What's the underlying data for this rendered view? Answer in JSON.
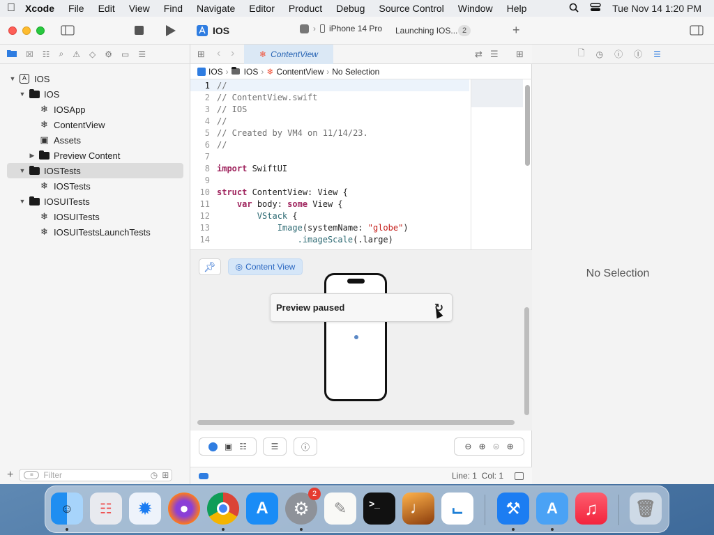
{
  "menubar": {
    "items": [
      "Xcode",
      "File",
      "Edit",
      "View",
      "Find",
      "Navigate",
      "Editor",
      "Product",
      "Debug",
      "Source Control",
      "Window",
      "Help"
    ],
    "clock": "Tue Nov 14  1:20 PM"
  },
  "toolbar": {
    "project": "IOS",
    "device": "iPhone 14 Pro",
    "status": "Launching IOS...",
    "badge": "2"
  },
  "navigator": {
    "items": [
      {
        "label": "IOS"
      },
      {
        "label": "IOS"
      },
      {
        "label": "IOSApp"
      },
      {
        "label": "ContentView"
      },
      {
        "label": "Assets"
      },
      {
        "label": "Preview Content"
      },
      {
        "label": "IOSTests"
      },
      {
        "label": "IOSTests"
      },
      {
        "label": "IOSUITests"
      },
      {
        "label": "IOSUITests"
      },
      {
        "label": "IOSUITestsLaunchTests"
      }
    ],
    "filter_placeholder": "Filter"
  },
  "editor": {
    "tab": "ContentView",
    "jumpbar": [
      "IOS",
      "IOS",
      "ContentView",
      "No Selection"
    ],
    "lines": [
      {
        "n": "1",
        "t": "//"
      },
      {
        "n": "2",
        "t": "//  ContentView.swift"
      },
      {
        "n": "3",
        "t": "//  IOS"
      },
      {
        "n": "4",
        "t": "//"
      },
      {
        "n": "5",
        "t": "//  Created by VM4 on 11/14/23."
      },
      {
        "n": "6",
        "t": "//"
      },
      {
        "n": "7",
        "t": ""
      },
      {
        "n": "8",
        "kw": "import",
        "rest": " SwiftUI"
      },
      {
        "n": "9",
        "t": ""
      },
      {
        "n": "10",
        "kw": "struct",
        "rest": " ContentView: View {"
      },
      {
        "n": "11",
        "pre": "    ",
        "kw": "var",
        "rest": " body: ",
        "kw2": "some",
        "rest2": " View {"
      },
      {
        "n": "12",
        "pre": "        ",
        "fn": "VStack",
        "rest": " {"
      },
      {
        "n": "13",
        "pre": "            ",
        "fn": "Image",
        "rest": "(systemName: ",
        "str": "\"globe\"",
        "rest2": ")"
      },
      {
        "n": "14",
        "pre": "                ",
        "fn": ".imageScale",
        "rest": "(.large)"
      }
    ]
  },
  "canvas": {
    "chip": "Content View",
    "paused": "Preview paused"
  },
  "status": {
    "position": "Line: 1  Col: 1"
  },
  "inspector": {
    "empty": "No Selection"
  },
  "dock": {
    "badge": "2"
  }
}
